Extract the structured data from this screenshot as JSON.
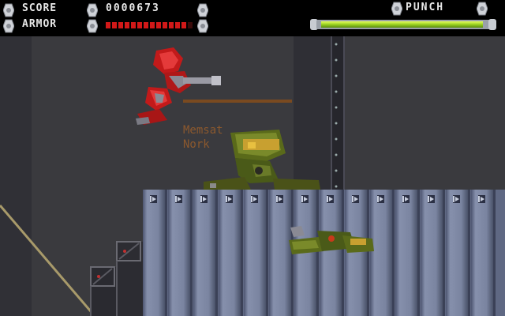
{
  "hud": {
    "score_label": "SCORE",
    "score_value": "0000673",
    "armor_label": "ARMOR",
    "armor_level": 0.95,
    "weapon_label": "PUNCH",
    "weapon_level": 0.93
  },
  "scene": {
    "sign_text_line1": "Memsat",
    "sign_text_line2": "Nork"
  },
  "colors": {
    "armor": "#d21818",
    "weapon": "#98d020",
    "background": "#3a3a3e",
    "lockers": "#7a84a0"
  },
  "icons": [
    "hex-bolt-icon"
  ]
}
